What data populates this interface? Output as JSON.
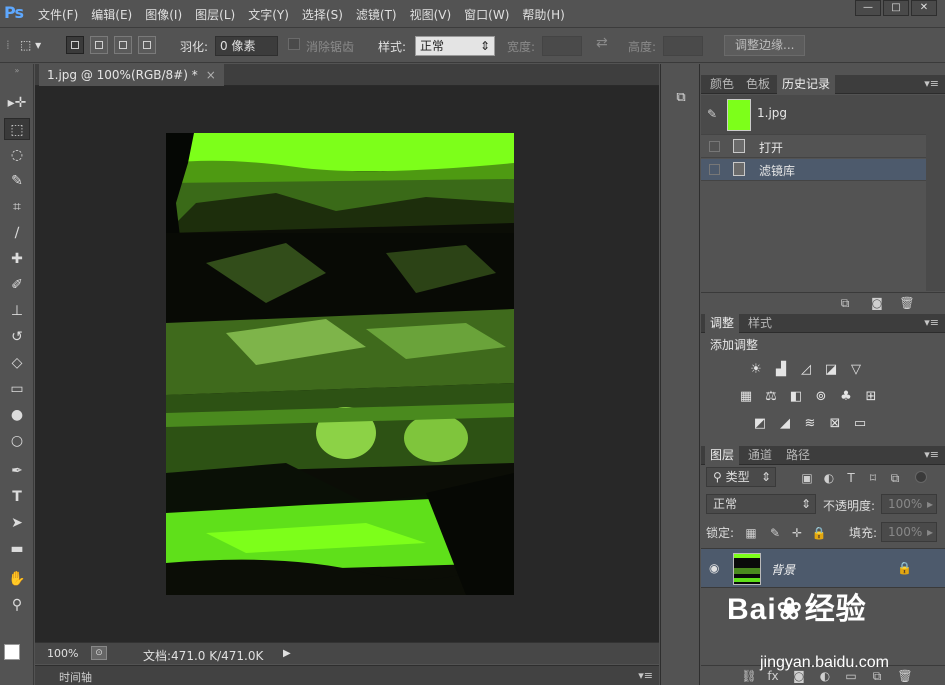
{
  "app": {
    "logo": "Ps"
  },
  "menu": [
    "文件(F)",
    "编辑(E)",
    "图像(I)",
    "图层(L)",
    "文字(Y)",
    "选择(S)",
    "滤镜(T)",
    "视图(V)",
    "窗口(W)",
    "帮助(H)"
  ],
  "window_controls": {
    "minimize": "—",
    "maximize": "□",
    "close": "✕"
  },
  "options": {
    "feather_label": "羽化:",
    "feather_value": "0 像素",
    "antialias_label": "消除锯齿",
    "style_label": "样式:",
    "style_value": "正常",
    "width_label": "宽度:",
    "height_label": "高度:",
    "refine_edge": "调整边缘..."
  },
  "document": {
    "tab_title": "1.jpg @ 100%(RGB/8#) *",
    "tab_close": "×",
    "zoom": "100%",
    "doc_info": "文档:471.0 K/471.0K",
    "timeline_label": "时间轴"
  },
  "panels": {
    "top_tabs": [
      "颜色",
      "色板",
      "历史记录"
    ],
    "history": {
      "snapshot": "1.jpg",
      "items": [
        "打开",
        "滤镜库"
      ]
    },
    "adjust_tabs": [
      "调整",
      "样式"
    ],
    "adjust_title": "添加调整",
    "layers_tabs": [
      "图层",
      "通道",
      "路径"
    ],
    "layers": {
      "filter_kind": "类型",
      "blend_mode": "正常",
      "opacity_label": "不透明度:",
      "opacity_value": "100%",
      "lock_label": "锁定:",
      "fill_label": "填充:",
      "fill_value": "100%",
      "layer_name": "背景"
    }
  },
  "watermark": {
    "brand": "Bai",
    "brand2": "经验",
    "url": "jingyan.baidu.com"
  },
  "colors": {
    "ui_bg": "#535353",
    "canvas_bg": "#282828",
    "image_green": "#7dff1a",
    "selected_row": "#4d5a6c"
  }
}
